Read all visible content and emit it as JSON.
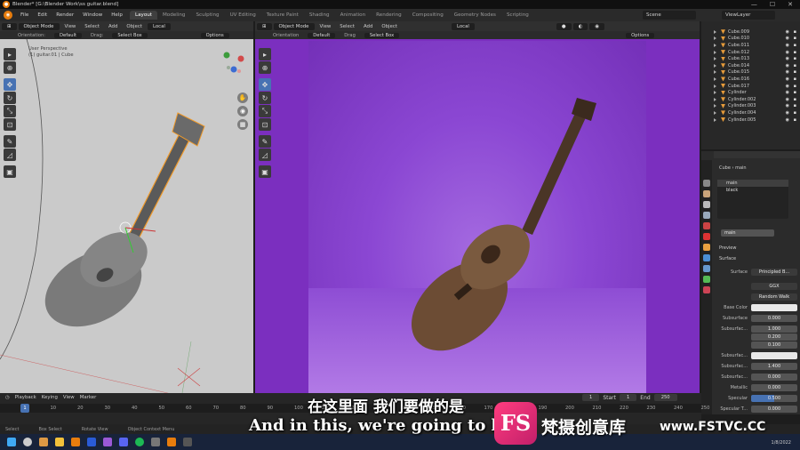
{
  "window": {
    "title": "Blender* [G:\\Blender Work\\ss guitar.blend]",
    "min": "—",
    "max": "☐",
    "close": "✕"
  },
  "menu": [
    "File",
    "Edit",
    "Render",
    "Window",
    "Help"
  ],
  "workspaces": [
    "Layout",
    "Modeling",
    "Sculpting",
    "UV Editing",
    "Texture Paint",
    "Shading",
    "Animation",
    "Rendering",
    "Compositing",
    "Geometry Nodes",
    "Scripting"
  ],
  "scene": "Scene",
  "view_layer": "ViewLayer",
  "left_viewport": {
    "mode": "Object Mode",
    "menus": [
      "View",
      "Select",
      "Add",
      "Object"
    ],
    "transform": "Local",
    "orientation_label": "Orientation:",
    "orientation": "Default",
    "drag_label": "Drag:",
    "drag": "Select Box",
    "options": "Options",
    "info_line1": "User Perspective",
    "info_line2": "(1) guitar.01 | Cube"
  },
  "right_viewport": {
    "mode": "Object Mode",
    "menus": [
      "View",
      "Select",
      "Add",
      "Object"
    ],
    "transform": "Local",
    "orientation_label": "Orientation",
    "orientation": "Default",
    "drag_label": "Drag",
    "drag": "Select Box",
    "options": "Options"
  },
  "outliner": [
    "Cube.009",
    "Cube.010",
    "Cube.011",
    "Cube.012",
    "Cube.013",
    "Cube.014",
    "Cube.015",
    "Cube.016",
    "Cube.017",
    "Cylinder",
    "Cylinder.002",
    "Cylinder.003",
    "Cylinder.004",
    "Cylinder.005"
  ],
  "properties": {
    "breadcrumb_object": "Cube",
    "breadcrumb_material": "main",
    "slots": [
      "main",
      "black"
    ],
    "material_name": "main",
    "preview": "Preview",
    "surface_section": "Surface",
    "surface_label": "Surface",
    "surface_value": "Principled B...",
    "distribution": "GGX",
    "subsurface_method": "Random Walk",
    "rows": [
      {
        "label": "Base Color",
        "value": ""
      },
      {
        "label": "Subsurface",
        "value": "0.000"
      },
      {
        "label": "Subsurfac...",
        "value": "1.000"
      },
      {
        "label": "",
        "value": "0.200"
      },
      {
        "label": "",
        "value": "0.100"
      },
      {
        "label": "Subsurfac...",
        "value": ""
      },
      {
        "label": "Subsurfac...",
        "value": "1.400"
      },
      {
        "label": "Subsurfac...",
        "value": "0.000"
      },
      {
        "label": "Metallic",
        "value": "0.000"
      },
      {
        "label": "Specular",
        "value": "0.500"
      },
      {
        "label": "Specular T...",
        "value": "0.000"
      }
    ]
  },
  "timeline": {
    "menus": [
      "Playback",
      "Keying",
      "View",
      "Marker"
    ],
    "current_frame": "1",
    "start_label": "Start",
    "start": "1",
    "end_label": "End",
    "end": "250",
    "ticks": [
      "1",
      "10",
      "20",
      "30",
      "40",
      "50",
      "60",
      "70",
      "80",
      "90",
      "100",
      "110",
      "120",
      "130",
      "140",
      "150",
      "160",
      "170",
      "180",
      "190",
      "200",
      "210",
      "220",
      "230",
      "240",
      "250"
    ]
  },
  "status": [
    "Select",
    "Box Select",
    "Rotate View",
    "Object Context Menu"
  ],
  "taskbar": {
    "date": "1/8/2022"
  },
  "subtitles": {
    "chinese": "在这里面 我们要做的是",
    "english": "And in this, we're going to b"
  },
  "watermark": {
    "logo": "FS",
    "name": "梵摄创意库",
    "url": "www.FSTVC.CC"
  },
  "colors": {
    "accent": "#4772b3",
    "render_bg": "#7b2fbf",
    "blender_orange": "#e87d0d"
  }
}
